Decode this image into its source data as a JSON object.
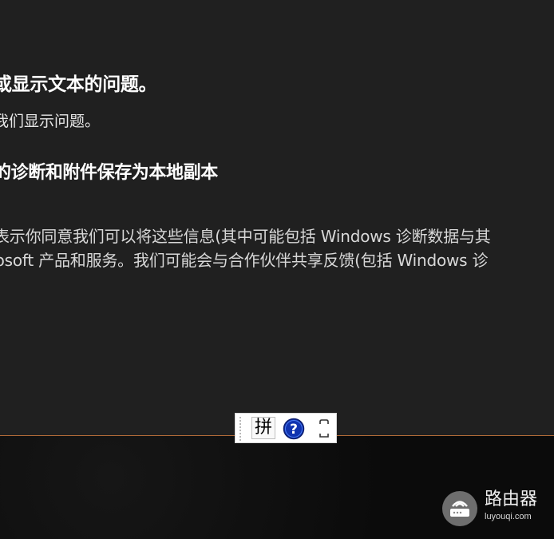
{
  "dialog": {
    "heading": "或显示文本的问题。",
    "subtext": "我们显示问题。",
    "checkbox_label": "的诊断和附件保存为本地副本",
    "consent_line_1": "表示你同意我们可以将这些信息(其中可能包括 Windows 诊断数据与其",
    "consent_line_2": "rosoft 产品和服务。我们可能会与合作伙伴共享反馈(包括 Windows 诊"
  },
  "ime_toolbar": {
    "input_mode": "拼",
    "help_icon": "help-icon",
    "mode_icon": "fullwidth-halfwidth-icon"
  },
  "watermark": {
    "title": "路由器",
    "subtitle": "luyouqi.com",
    "icon": "router-icon"
  },
  "colors": {
    "background": "#202020",
    "taskbar": "#0b0b0b",
    "accent_line": "#b26b38",
    "help_blue": "#1033b0"
  }
}
